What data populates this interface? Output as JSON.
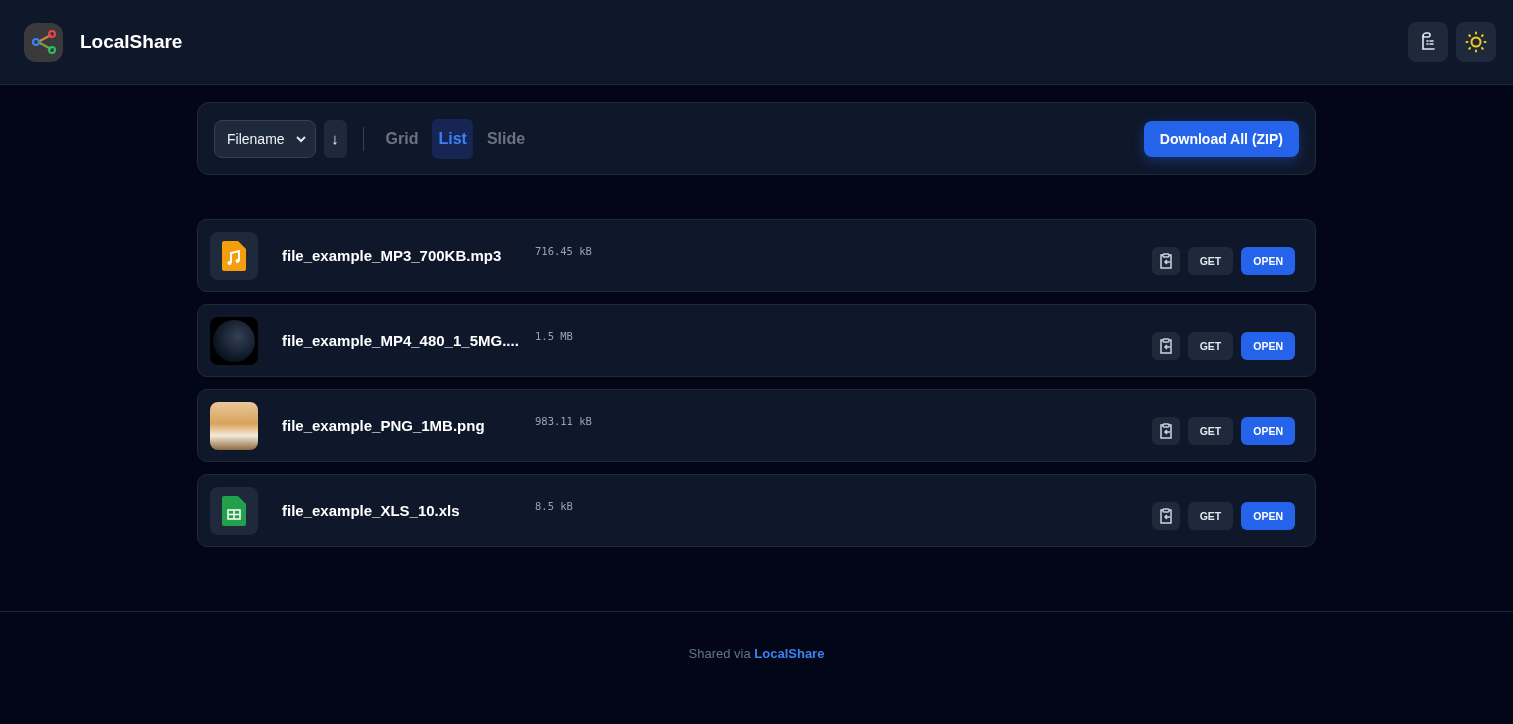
{
  "app": {
    "title": "LocalShare"
  },
  "toolbar": {
    "sort_select": {
      "value": "Filename"
    },
    "sort_direction": "↓",
    "views": [
      {
        "label": "Grid",
        "selected": false
      },
      {
        "label": "List",
        "selected": true
      },
      {
        "label": "Slide",
        "selected": false
      }
    ],
    "download_all": "Download All (ZIP)"
  },
  "files": [
    {
      "name": "file_example_MP3_700KB.mp3",
      "size": "716.45 kB",
      "kind": "audio",
      "get": "GET",
      "open": "OPEN"
    },
    {
      "name": "file_example_MP4_480_1_5MG....",
      "size": "1.5 MB",
      "kind": "video",
      "get": "GET",
      "open": "OPEN"
    },
    {
      "name": "file_example_PNG_1MB.png",
      "size": "983.11 kB",
      "kind": "image",
      "get": "GET",
      "open": "OPEN"
    },
    {
      "name": "file_example_XLS_10.xls",
      "size": "8.5 kB",
      "kind": "sheet",
      "get": "GET",
      "open": "OPEN"
    }
  ],
  "footer": {
    "prefix": "Shared via",
    "link": "LocalShare"
  }
}
